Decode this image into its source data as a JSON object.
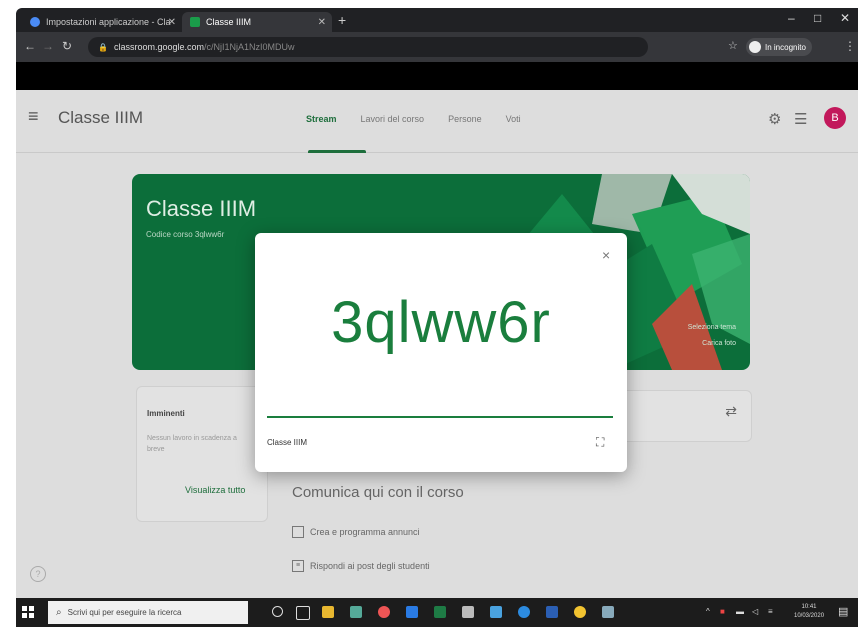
{
  "browser": {
    "tabs": [
      {
        "label": "Impostazioni applicazione - Cla",
        "active": false
      },
      {
        "label": "Classe IIIM",
        "active": true
      }
    ],
    "new_tab": "+",
    "url_domain": "classroom.google.com",
    "url_path": "/c/NjI1NjA1NzI0MDUw",
    "profile_label": "In incognito"
  },
  "classroom": {
    "menu_icon": "hamburger-icon",
    "class_name": "Classe IIIM",
    "tabs": [
      "Stream",
      "Lavori del corso",
      "Persone",
      "Voti"
    ],
    "active_tab": "Stream",
    "avatar_letter": "B",
    "banner": {
      "title": "Classe IIIM",
      "subtitle": "Codice corso  3qlww6r",
      "link_1": "Seleziona tema",
      "link_2": "Carica foto"
    },
    "upcoming": {
      "title": "Imminenti",
      "text": "Nessun lavoro in scadenza a breve",
      "link": "Visualizza tutto"
    },
    "post": {
      "title": "Comunica qui con il corso",
      "item_1": "Crea e programma annunci",
      "item_2": "Rispondi ai post degli studenti"
    }
  },
  "modal": {
    "code": "3qlww6r",
    "close": "×",
    "class_name": "Classe IIIM",
    "fullscreen_icon": "fullscreen-icon"
  },
  "taskbar": {
    "search_placeholder": "Scrivi qui per eseguire la ricerca",
    "time": "10:41",
    "date": "10/03/2020"
  },
  "colors": {
    "accent_green": "#1a7e3d",
    "banner_green": "#0c6e3a",
    "avatar": "#c2185b"
  }
}
